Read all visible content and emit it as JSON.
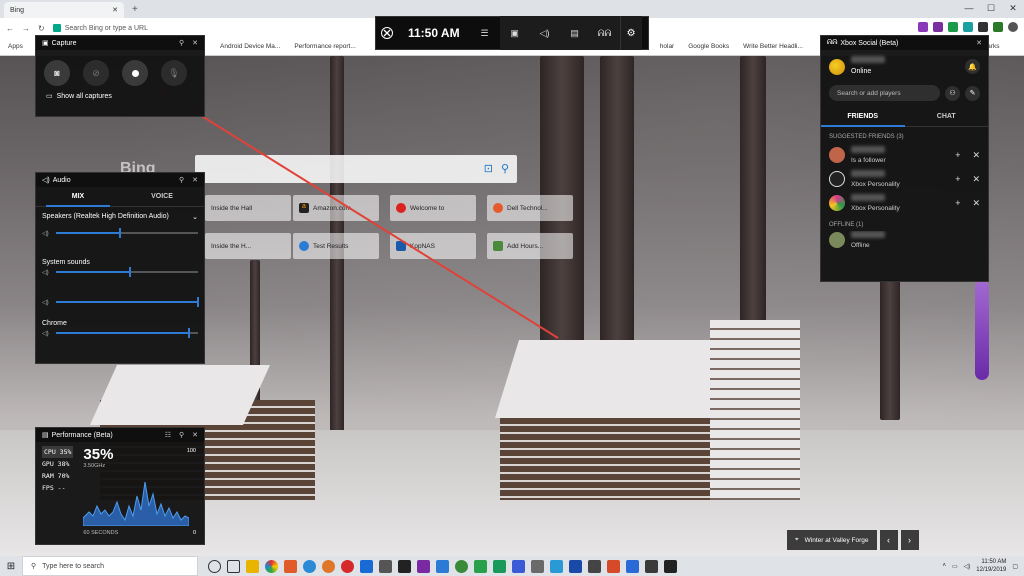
{
  "browser": {
    "tab_title": "Bing",
    "address_placeholder": "Search Bing or type a URL",
    "bookmarks": [
      "Apps",
      "Android Device Ma...",
      "Performance report...",
      "holar",
      "Google Books",
      "Write Better Headli...",
      "Bookmarks"
    ]
  },
  "bing": {
    "logo": "Bing",
    "tiles": [
      "Inside the Hall",
      "Amazon.com",
      "Welcome to",
      "Dell Technol...",
      "Inside the H...",
      "Test Results",
      "KopNAS",
      "Add Hours..."
    ]
  },
  "gamebar": {
    "time": "11:50 AM",
    "icons": [
      "xbox-icon",
      "menu-icon",
      "capture-icon",
      "audio-icon",
      "performance-icon",
      "social-icon",
      "settings-icon"
    ]
  },
  "capture": {
    "title": "Capture",
    "show_all": "Show all captures"
  },
  "audio": {
    "title": "Audio",
    "tab_mix": "MIX",
    "tab_voice": "VOICE",
    "device": "Speakers (Realtek High Definition Audio)",
    "device_level": 0.45,
    "system_label": "System sounds",
    "system_level": 0.52,
    "system_level2": 1.0,
    "chrome_label": "Chrome",
    "chrome_level": 0.94
  },
  "performance": {
    "title": "Performance (Beta)",
    "rows": [
      {
        "name": "CPU",
        "value": "35%"
      },
      {
        "name": "GPU",
        "value": "38%"
      },
      {
        "name": "RAM",
        "value": "70%"
      },
      {
        "name": "FPS",
        "value": "--"
      }
    ],
    "big_value": "35%",
    "clock": "3.50GHz",
    "max_label": "100",
    "min_label": "0",
    "duration_label": "60 SECONDS"
  },
  "social": {
    "title": "Xbox Social (Beta)",
    "status": "Online",
    "search_placeholder": "Search or add players",
    "tab_friends": "FRIENDS",
    "tab_chat": "CHAT",
    "suggested_header": "SUGGESTED FRIENDS (3)",
    "suggested": [
      {
        "subtitle": "Is a follower"
      },
      {
        "subtitle": "Xbox Personality"
      },
      {
        "subtitle": "Xbox Personality"
      }
    ],
    "offline_header": "OFFLINE (1)",
    "offline_status": "Offline"
  },
  "caption": {
    "title": "Winter at Valley Forge"
  },
  "taskbar": {
    "search_placeholder": "Type here to search",
    "time": "11:50 AM",
    "date": "12/19/2019"
  },
  "colors": {
    "accent": "#2e7bd6",
    "arrow": "#e0423a"
  }
}
